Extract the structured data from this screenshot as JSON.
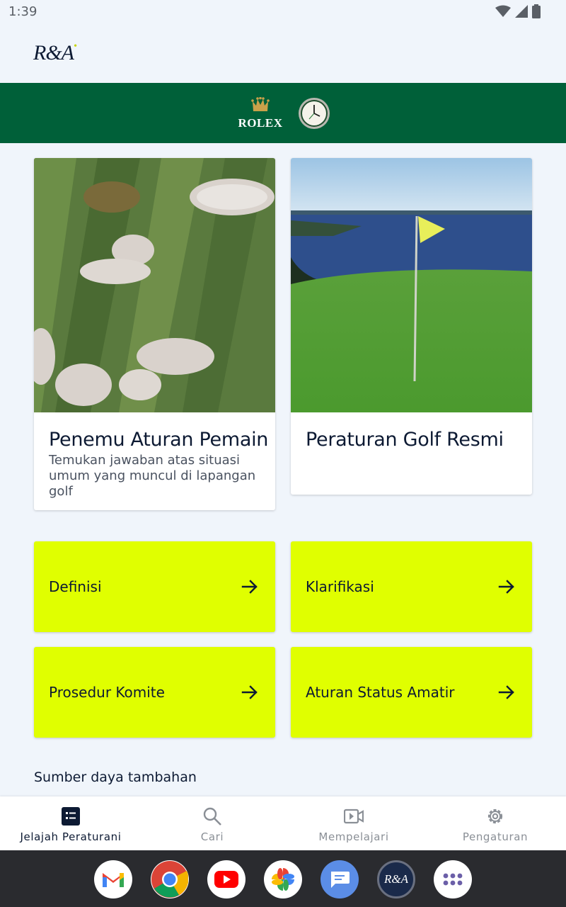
{
  "status_bar": {
    "time": "1:39",
    "icons": [
      "wifi-icon",
      "signal-icon",
      "battery-icon"
    ]
  },
  "header": {
    "logo_text": "R&A"
  },
  "sponsor": {
    "name": "ROLEX"
  },
  "cards": [
    {
      "title": "Penemu Aturan Pemain",
      "description": "Temukan jawaban atas situasi umum yang muncul di lapangan golf"
    },
    {
      "title": "Peraturan Golf Resmi",
      "description": ""
    }
  ],
  "tiles": [
    {
      "label": "Definisi"
    },
    {
      "label": "Klarifikasi"
    },
    {
      "label": "Prosedur Komite"
    },
    {
      "label": "Aturan Status Amatir"
    }
  ],
  "resources": {
    "label": "Sumber daya tambahan"
  },
  "bottom_nav": [
    {
      "label": "Jelajah Peraturani",
      "icon": "rules-book-icon",
      "active": true
    },
    {
      "label": "Cari",
      "icon": "search-icon",
      "active": false
    },
    {
      "label": "Mempelajari",
      "icon": "video-icon",
      "active": false
    },
    {
      "label": "Pengaturan",
      "icon": "gear-icon",
      "active": false
    }
  ],
  "dock": {
    "apps": [
      "gmail",
      "chrome",
      "youtube",
      "photos",
      "messages",
      "r-and-a",
      "app-drawer"
    ],
    "ra_badge": "R&A"
  },
  "colors": {
    "brand_green": "#006039",
    "accent_lime": "#e0ff00",
    "navy": "#0d1a33",
    "background": "#f0f5fb"
  }
}
